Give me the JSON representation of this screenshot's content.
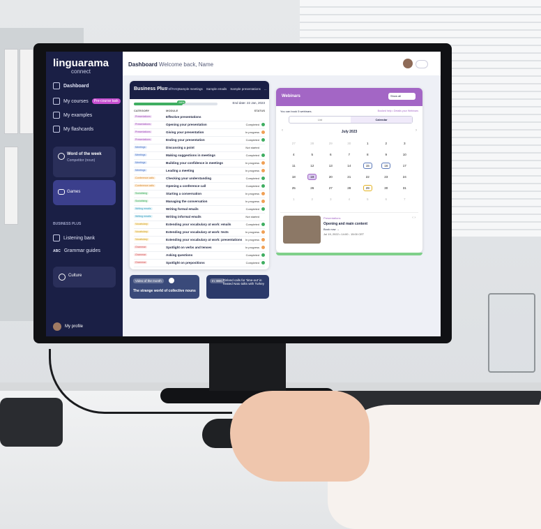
{
  "app": {
    "logo": "linguarama",
    "logo_sub": "connect"
  },
  "sidebar": {
    "items": [
      {
        "label": "Dashboard",
        "icon": "grid-icon"
      },
      {
        "label": "My courses",
        "icon": "book-icon",
        "badge": "Pre-course task"
      },
      {
        "label": "My examples",
        "icon": "list-icon"
      },
      {
        "label": "My flashcards",
        "icon": "cards-icon"
      }
    ],
    "word_of_week": {
      "title": "Word of the week",
      "subtitle": "Competitor (noun)"
    },
    "games": {
      "label": "Games"
    },
    "section_title": "BUSINESS PLUS",
    "section_items": [
      {
        "label": "Listening bank",
        "icon": "headphones-icon"
      },
      {
        "label": "Grammar guides",
        "icon": "abc-icon",
        "prefix": "ABC"
      }
    ],
    "culture": {
      "label": "Culture"
    },
    "profile": {
      "label": "My profile"
    }
  },
  "header": {
    "title": "Dashboard",
    "welcome": "Welcome back, Name"
  },
  "course": {
    "name": "Business Plus",
    "pathway": "Pathway",
    "tabs": [
      "Sample meetings",
      "Sample emails",
      "Sample presentations",
      "..."
    ],
    "progress": {
      "percent": 0.58,
      "label": "58%"
    },
    "end_date": "End date: 22 Jan, 2023",
    "columns": {
      "category": "CATEGORY",
      "module": "MODULE",
      "status": "STATUS"
    },
    "rows": [
      {
        "category": "Presentations",
        "module": "Effective presentations",
        "status": "",
        "dot": ""
      },
      {
        "category": "Presentations",
        "module": "Opening your presentation",
        "status": "Completed",
        "dot": "green"
      },
      {
        "category": "Presentations",
        "module": "Giving your presentation",
        "status": "In progress",
        "dot": "orange"
      },
      {
        "category": "Presentations",
        "module": "Ending your presentation",
        "status": "Completed",
        "dot": "green"
      },
      {
        "category": "Meetings",
        "module": "Discussing a point",
        "status": "Not started",
        "dot": ""
      },
      {
        "category": "Meetings",
        "module": "Making suggestions in meetings",
        "status": "Completed",
        "dot": "green"
      },
      {
        "category": "Meetings",
        "module": "Building your confidence in meetings",
        "status": "In progress",
        "dot": "orange"
      },
      {
        "category": "Meetings",
        "module": "Leading a meeting",
        "status": "In progress",
        "dot": "orange"
      },
      {
        "category": "Conference calls",
        "module": "Checking your understanding",
        "status": "Completed",
        "dot": "green"
      },
      {
        "category": "Conference calls",
        "module": "Opening a conference call",
        "status": "Completed",
        "dot": "green"
      },
      {
        "category": "Socialising",
        "module": "Starting a conversation",
        "status": "In progress",
        "dot": "orange"
      },
      {
        "category": "Socialising",
        "module": "Managing the conversation",
        "status": "In progress",
        "dot": "orange"
      },
      {
        "category": "Writing emails",
        "module": "Writing formal emails",
        "status": "Completed",
        "dot": "green"
      },
      {
        "category": "Writing emails",
        "module": "Writing informal emails",
        "status": "Not started",
        "dot": ""
      },
      {
        "category": "Vocabulary",
        "module": "Extending your vocabulary at work: emails",
        "status": "Completed",
        "dot": "green"
      },
      {
        "category": "Vocabulary",
        "module": "Extending your vocabulary at work: texts",
        "status": "In progress",
        "dot": "orange"
      },
      {
        "category": "Vocabulary",
        "module": "Extending your vocabulary at work: presentations",
        "status": "In progress",
        "dot": "orange"
      },
      {
        "category": "Grammar",
        "module": "Spotlight on verbs and tenses",
        "status": "In progress",
        "dot": "orange"
      },
      {
        "category": "Grammar",
        "module": "Asking questions",
        "status": "Completed",
        "dot": "green"
      },
      {
        "category": "Grammar",
        "module": "Spotlight on prepositions",
        "status": "Completed",
        "dot": "green"
      }
    ],
    "status_completed_note": "Completed"
  },
  "video": {
    "label": "Video of the month",
    "title": "The strange world of collective nouns"
  },
  "news": {
    "label": "In: BBC",
    "title": "Finland calls for 'time-out' in heated Nato talks with Turkey"
  },
  "webinars": {
    "title": "Webinars",
    "show": "Show all",
    "can_book": "You can book 5 webinars.",
    "links": "Booked help • Details your Webinars",
    "segments": [
      "List",
      "Calendar"
    ],
    "month": "July 2023",
    "weeks": [
      [
        "27",
        "28",
        "29",
        "30",
        "1",
        "2",
        "3"
      ],
      [
        "4",
        "5",
        "6",
        "7",
        "8",
        "9",
        "10"
      ],
      [
        "11",
        "12",
        "13",
        "14",
        "15",
        "16",
        "17"
      ],
      [
        "18",
        "19",
        "20",
        "21",
        "22",
        "23",
        "24"
      ],
      [
        "25",
        "26",
        "27",
        "28",
        "29",
        "30",
        "31"
      ],
      [
        "1",
        "2",
        "3",
        "4",
        "5",
        "6",
        "7"
      ]
    ],
    "event": {
      "tag": "Presentations",
      "title": "Opening and main content",
      "book": "Book now →",
      "date": "Jul 19, 2022 • 14:00 - 15:00 CET"
    }
  },
  "colors": {
    "sidebar": "#1a1f45",
    "accent": "#a366c5",
    "green": "#3fae61",
    "orange": "#f0a055"
  }
}
